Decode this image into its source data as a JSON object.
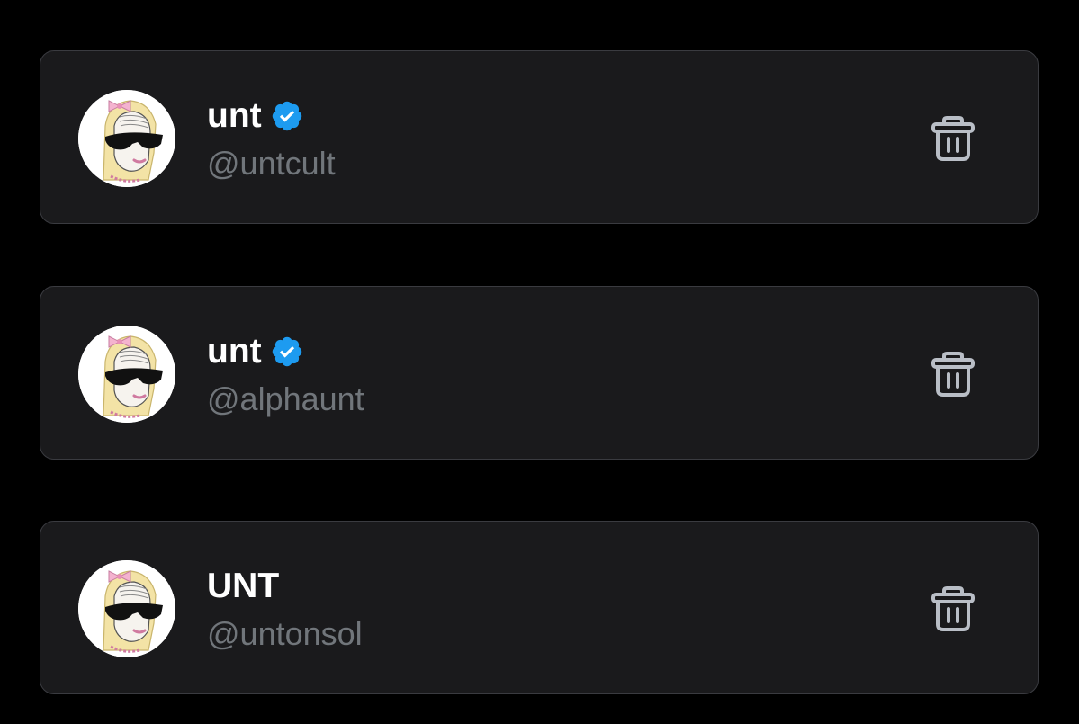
{
  "accounts": [
    {
      "display_name": "unt",
      "handle": "@untcult",
      "verified": true,
      "avatar_icon": "avatar-cartoon-woman-sunglasses",
      "delete_icon": "trash-icon"
    },
    {
      "display_name": "unt",
      "handle": "@alphaunt",
      "verified": true,
      "avatar_icon": "avatar-cartoon-woman-sunglasses",
      "delete_icon": "trash-icon"
    },
    {
      "display_name": "UNT",
      "handle": "@untonsol",
      "verified": false,
      "avatar_icon": "avatar-cartoon-woman-sunglasses",
      "delete_icon": "trash-icon"
    }
  ],
  "colors": {
    "background": "#000000",
    "card_background": "#1a1a1c",
    "card_border": "#3a3b40",
    "name_text": "#ffffff",
    "handle_text": "#71767b",
    "verified_badge": "#1d9bf0",
    "trash_icon": "#b9bec6"
  }
}
